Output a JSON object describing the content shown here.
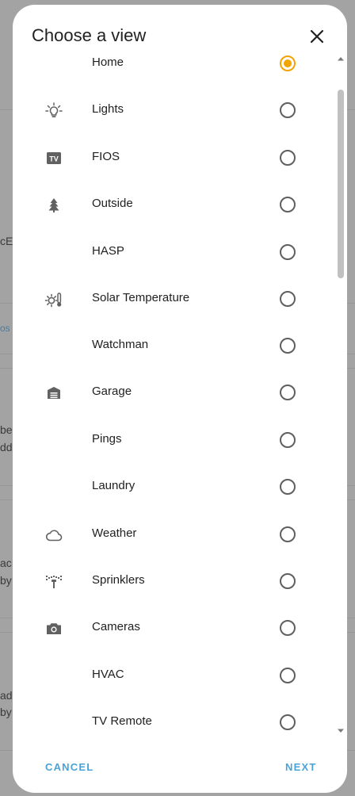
{
  "background": {
    "fragments": [
      "cEC",
      "os",
      "be",
      "dd",
      "ac",
      "by",
      "ad",
      "by"
    ]
  },
  "dialog": {
    "title": "Choose a view",
    "close_icon": "close-icon",
    "items": [
      {
        "label": "Home",
        "icon": "",
        "selected": true
      },
      {
        "label": "Lights",
        "icon": "lightbulb-icon",
        "selected": false
      },
      {
        "label": "FIOS",
        "icon": "tv-icon",
        "selected": false
      },
      {
        "label": "Outside",
        "icon": "pine-tree-icon",
        "selected": false
      },
      {
        "label": "HASP",
        "icon": "",
        "selected": false
      },
      {
        "label": "Solar Temperature",
        "icon": "sun-thermometer-icon",
        "selected": false
      },
      {
        "label": "Watchman",
        "icon": "",
        "selected": false
      },
      {
        "label": "Garage",
        "icon": "garage-icon",
        "selected": false
      },
      {
        "label": "Pings",
        "icon": "",
        "selected": false
      },
      {
        "label": "Laundry",
        "icon": "",
        "selected": false
      },
      {
        "label": "Weather",
        "icon": "cloud-icon",
        "selected": false
      },
      {
        "label": "Sprinklers",
        "icon": "sprinkler-icon",
        "selected": false
      },
      {
        "label": "Cameras",
        "icon": "camera-icon",
        "selected": false
      },
      {
        "label": "HVAC",
        "icon": "",
        "selected": false
      },
      {
        "label": "TV Remote",
        "icon": "",
        "selected": false
      }
    ],
    "cancel_label": "CANCEL",
    "next_label": "NEXT",
    "accent_color": "#f2a400",
    "button_color": "#4aa3d8"
  }
}
